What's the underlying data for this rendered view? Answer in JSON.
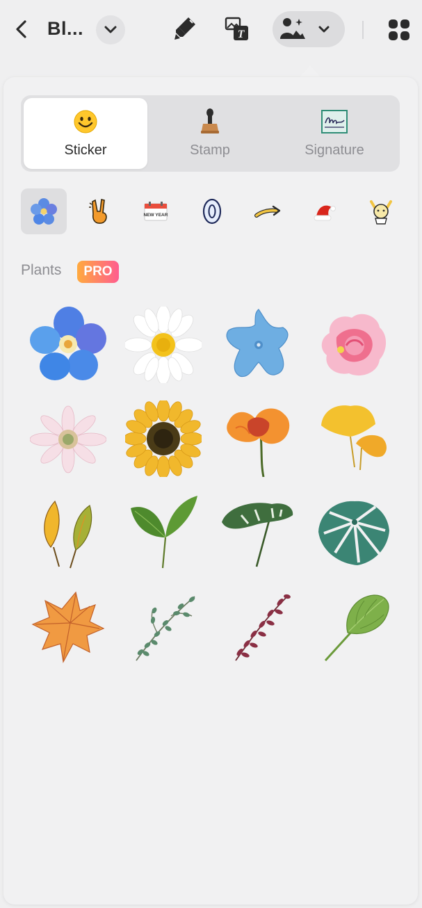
{
  "toolbar": {
    "doc_title": "Bl...",
    "icons": [
      "back-icon",
      "chevron-down-icon",
      "marker-icon",
      "text-image-icon",
      "sticker-icon",
      "apps-icon"
    ]
  },
  "panel": {
    "tabs": [
      {
        "label": "Sticker",
        "icon": "smiley-icon",
        "active": true
      },
      {
        "label": "Stamp",
        "icon": "stamp-icon",
        "active": false
      },
      {
        "label": "Signature",
        "icon": "signature-icon",
        "active": false
      }
    ],
    "categories": [
      "flower",
      "peace-hand",
      "new-year-calendar",
      "zero-balloon",
      "arrow",
      "santa-hat",
      "character"
    ],
    "category_labels": {
      "new_year": "NEW YEAR"
    },
    "section": {
      "title": "Plants",
      "badge": "PRO"
    },
    "stickers": [
      "blue-forget-me-not",
      "white-daisy",
      "blue-star-flower",
      "pink-rose",
      "pink-gerbera",
      "sunflower",
      "orange-poppy",
      "ginkgo-leaves",
      "autumn-leaves",
      "green-sprout",
      "monstera-stem",
      "monstera-leaf",
      "maple-leaf",
      "eucalyptus-sprig",
      "red-berry-sprig",
      "hosta-leaf"
    ]
  },
  "colors": {
    "pro_gradient_start": "#ffaa3e",
    "pro_gradient_end": "#ff5d8f",
    "active_tab": "#ffffff"
  }
}
